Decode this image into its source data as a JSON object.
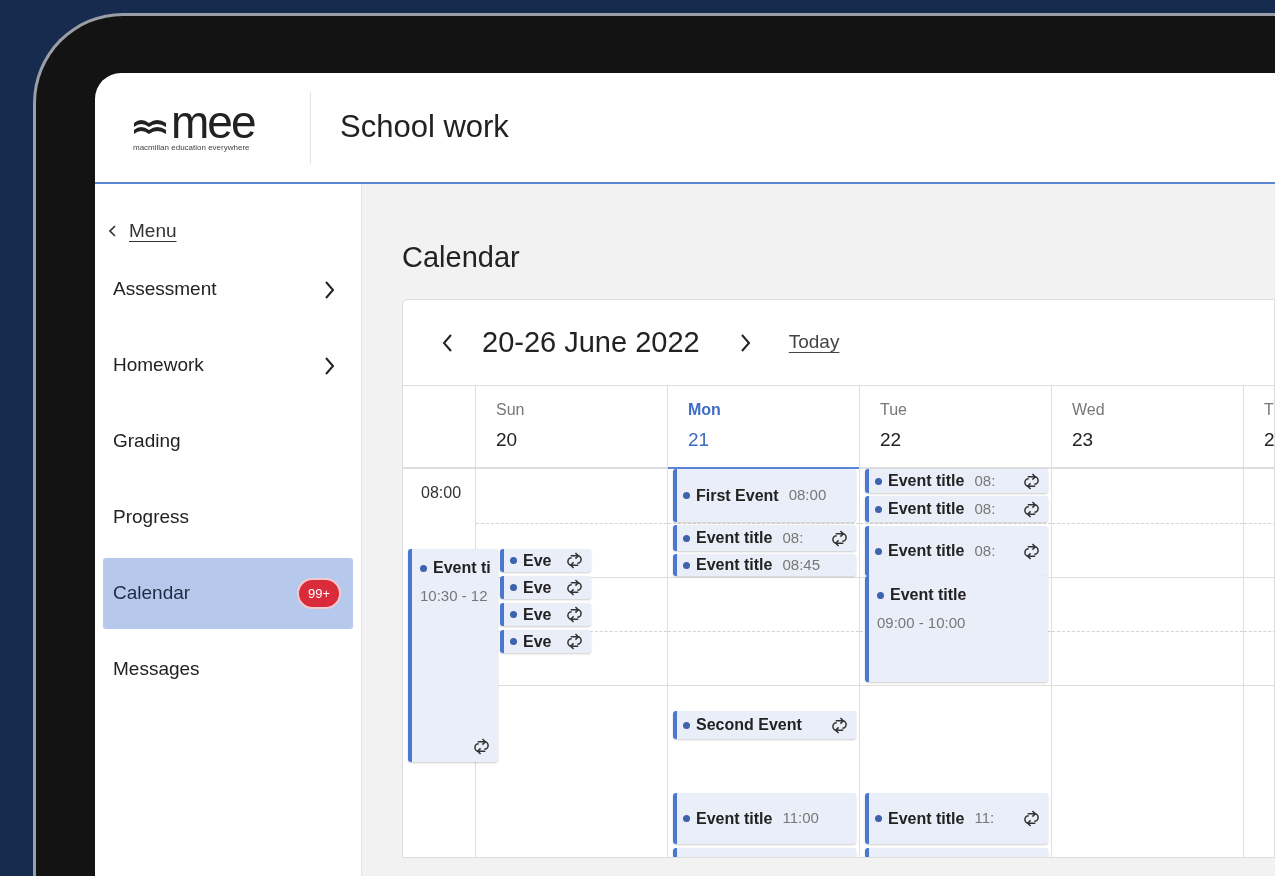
{
  "logo": {
    "wordmark": "mee",
    "tagline": "macmillan education everywhere"
  },
  "header": {
    "title": "School work"
  },
  "sidebar": {
    "back": "Menu",
    "items": [
      {
        "label": "Assessment",
        "has_submenu": true,
        "selected": false
      },
      {
        "label": "Homework",
        "has_submenu": true,
        "selected": false
      },
      {
        "label": "Grading",
        "has_submenu": false,
        "selected": false
      },
      {
        "label": "Progress",
        "has_submenu": false,
        "selected": false
      },
      {
        "label": "Calendar",
        "has_submenu": false,
        "selected": true,
        "badge": "99+"
      },
      {
        "label": "Messages",
        "has_submenu": false,
        "selected": false
      }
    ]
  },
  "page_title": "Calendar",
  "calendar": {
    "range": "20-26 June 2022",
    "today": "Today",
    "times": [
      "08:00"
    ],
    "days": [
      {
        "weekday": "Sun",
        "date": "20",
        "selected": false,
        "events": [
          {
            "kind": "block",
            "title": "Event ti",
            "time": "10:30 - 12",
            "repeat": true
          },
          {
            "kind": "chip",
            "title": "Eve",
            "repeat": true
          },
          {
            "kind": "chip",
            "title": "Eve",
            "repeat": true
          },
          {
            "kind": "chip",
            "title": "Eve",
            "repeat": true
          },
          {
            "kind": "chip",
            "title": "Eve",
            "repeat": true
          }
        ]
      },
      {
        "weekday": "Mon",
        "date": "21",
        "selected": true,
        "events": [
          {
            "kind": "chip",
            "title": "First Event",
            "time": "08:00",
            "repeat": false
          },
          {
            "kind": "chip",
            "title": "Event title",
            "time": "08:",
            "repeat": true
          },
          {
            "kind": "chip",
            "title": "Event title",
            "time": "08:45",
            "repeat": false
          },
          {
            "kind": "chip",
            "title": "Second Event",
            "repeat": true
          },
          {
            "kind": "chip",
            "title": "Event title",
            "time": "11:00",
            "repeat": false
          },
          {
            "kind": "chip"
          }
        ]
      },
      {
        "weekday": "Tue",
        "date": "22",
        "selected": false,
        "events": [
          {
            "kind": "chip",
            "title": "Event title",
            "time": "08:",
            "repeat": true
          },
          {
            "kind": "chip",
            "title": "Event title",
            "time": "08:",
            "repeat": true
          },
          {
            "kind": "chip",
            "title": "Event title",
            "time": "08:",
            "repeat": true
          },
          {
            "kind": "block",
            "title": "Event title",
            "time": "09:00 - 10:00",
            "repeat": false
          },
          {
            "kind": "chip",
            "title": "Event title",
            "time": "11:",
            "repeat": true
          },
          {
            "kind": "chip"
          }
        ]
      },
      {
        "weekday": "Wed",
        "date": "23",
        "selected": false
      },
      {
        "weekday": "T",
        "date": "2",
        "selected": false
      }
    ]
  }
}
